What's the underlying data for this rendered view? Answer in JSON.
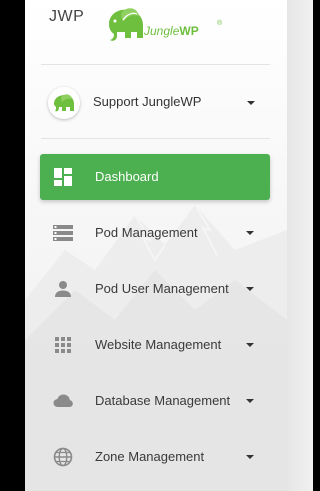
{
  "brand": {
    "short_name": "JWP",
    "logo_text_jungle": "Jungle",
    "logo_text_wp": "WP",
    "logo_reg": "®"
  },
  "user": {
    "label": "Support JungleWP"
  },
  "nav": {
    "items": [
      {
        "label": "Dashboard",
        "icon": "dashboard-icon",
        "active": true
      },
      {
        "label": "Pod Management",
        "icon": "server-list-icon",
        "active": false
      },
      {
        "label": "Pod User Management",
        "icon": "person-icon",
        "active": false
      },
      {
        "label": "Website Management",
        "icon": "grid-apps-icon",
        "active": false
      },
      {
        "label": "Database Management",
        "icon": "cloud-icon",
        "active": false
      },
      {
        "label": "Zone Management",
        "icon": "globe-icon",
        "active": false
      }
    ]
  },
  "colors": {
    "accent": "#4cb050",
    "logo_green": "#6fbf3f",
    "text": "#3a3a3a",
    "icon_gray": "#8a8a8a"
  }
}
